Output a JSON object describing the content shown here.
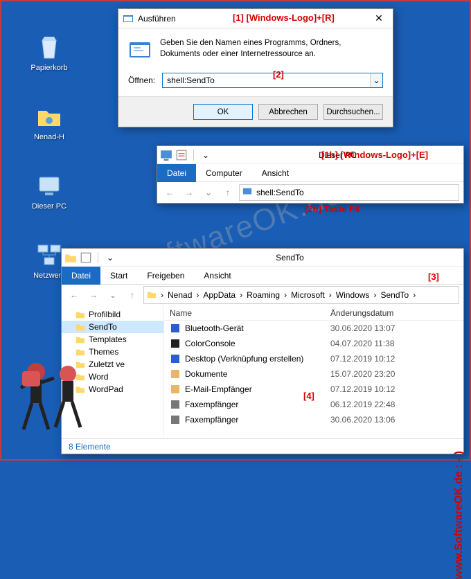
{
  "desktop": {
    "icons": [
      {
        "label": "Papierkorb"
      },
      {
        "label": "Nenad-H"
      },
      {
        "label": "Dieser PC"
      },
      {
        "label": "Netzwerk"
      }
    ]
  },
  "run": {
    "title": "Ausführen",
    "desc": "Geben Sie den Namen eines Programms, Ordners, Dokuments oder einer Internetressource an.",
    "open_label": "Öffnen:",
    "value": "shell:SendTo",
    "ok": "OK",
    "cancel": "Abbrechen",
    "browse": "Durchsuchen..."
  },
  "annotations": {
    "a1": "[1]   [Windows-Logo]+[R]",
    "a2": "[2]",
    "a1b": "[1b] [Windows-Logo]+[E]",
    "a2b": "[2b] Taste F4",
    "a3": "[3]",
    "a4": "[4]"
  },
  "explorer1": {
    "title": "Dieser PC",
    "tabs": {
      "file": "Datei",
      "computer": "Computer",
      "view": "Ansicht"
    },
    "address": "shell:SendTo"
  },
  "explorer2": {
    "title": "SendTo",
    "tabs": {
      "file": "Datei",
      "start": "Start",
      "share": "Freigeben",
      "view": "Ansicht"
    },
    "breadcrumbs": [
      "Nenad",
      "AppData",
      "Roaming",
      "Microsoft",
      "Windows",
      "SendTo"
    ],
    "tree": [
      {
        "label": "Profilbild"
      },
      {
        "label": "SendTo",
        "selected": true
      },
      {
        "label": "Templates"
      },
      {
        "label": "Themes"
      },
      {
        "label": "Zuletzt ve"
      },
      {
        "label": "Word"
      },
      {
        "label": "WordPad"
      }
    ],
    "columns": {
      "name": "Name",
      "date": "Änderungsdatum"
    },
    "files": [
      {
        "name": "Bluetooth-Gerät",
        "date": "30.06.2020 13:07",
        "ico": "#2b5cd3"
      },
      {
        "name": "ColorConsole",
        "date": "04.07.2020 11:38",
        "ico": "#222"
      },
      {
        "name": "Desktop (Verknüpfung erstellen)",
        "date": "07.12.2019 10:12",
        "ico": "#2b5cd3"
      },
      {
        "name": "Dokumente",
        "date": "15.07.2020 23:20",
        "ico": "#e8b763"
      },
      {
        "name": "E-Mail-Empfänger",
        "date": "07.12.2019 10:12",
        "ico": "#e8b763"
      },
      {
        "name": "Faxempfänger",
        "date": "06.12.2019 22:48",
        "ico": "#777"
      },
      {
        "name": "Faxempfänger",
        "date": "30.06.2020 13:06",
        "ico": "#777"
      }
    ],
    "status": "8 Elemente"
  },
  "watermark": "SoftwareOK.de",
  "sidetext": "www.SoftwareOK.de  : - )"
}
